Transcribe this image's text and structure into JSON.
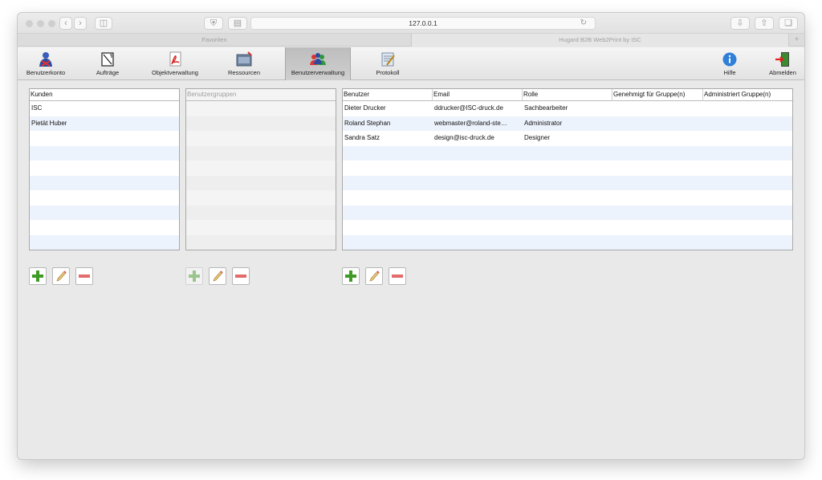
{
  "browser": {
    "url": "127.0.0.1",
    "tab_favorites": "Favoriten",
    "tab_active_title": "Hugard B2B Web2Print by ISC",
    "tab_plus": "+"
  },
  "toolbar": {
    "items": [
      {
        "label": "Benutzerkonto",
        "icon": "user-account-icon"
      },
      {
        "label": "Aufträge",
        "icon": "orders-icon"
      },
      {
        "label": "Objektverwaltung",
        "icon": "pdf-icon"
      },
      {
        "label": "Ressourcen",
        "icon": "resources-icon"
      },
      {
        "label": "Benutzerverwaltung",
        "icon": "users-group-icon",
        "active": true
      },
      {
        "label": "Protokoll",
        "icon": "protocol-icon"
      },
      {
        "label": "Hilfe",
        "icon": "info-icon"
      },
      {
        "label": "Abmelden",
        "icon": "logout-icon"
      }
    ]
  },
  "customers": {
    "header": "Kunden",
    "rows": [
      "ISC",
      "Pietät Huber"
    ]
  },
  "usergroups": {
    "header": "Benutzergruppen",
    "rows": []
  },
  "users": {
    "columns": [
      "Benutzer",
      "Email",
      "Rolle",
      "Genehmigt für Gruppe(n)",
      "Administriert Gruppe(n)"
    ],
    "rows": [
      {
        "name": "Dieter Drucker",
        "email": "ddrucker@ISC-druck.de",
        "role": "Sachbearbeiter",
        "approved": "",
        "admin": ""
      },
      {
        "name": "Roland Stephan",
        "email": "webmaster@roland-ste…",
        "role": "Administrator",
        "approved": "",
        "admin": ""
      },
      {
        "name": "Sandra Satz",
        "email": "design@isc-druck.de",
        "role": "Designer",
        "approved": "",
        "admin": ""
      }
    ]
  },
  "actions": {
    "add": "add-icon",
    "edit": "pencil-icon",
    "remove": "minus-icon"
  },
  "colors": {
    "row_alt": "#edf3fc",
    "add_green": "#3e9b23",
    "remove_red": "#e36b6b",
    "info_blue": "#2f7fd8"
  }
}
